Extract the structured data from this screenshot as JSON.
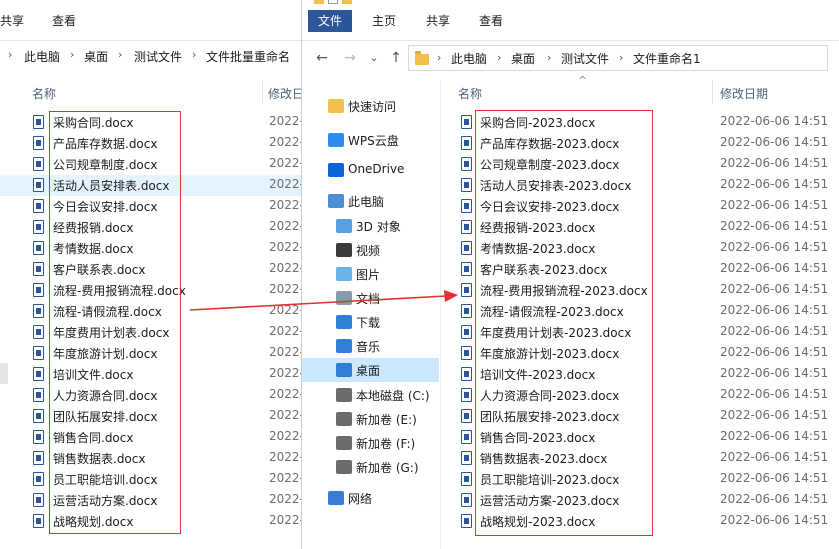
{
  "back_window": {
    "ribbon_tabs": [
      "共享",
      "查看"
    ],
    "breadcrumb": [
      "此电脑",
      "桌面",
      "测试文件",
      "文件批量重命名"
    ],
    "col_name": "名称",
    "col_date": "修改日",
    "files": [
      {
        "name": "采购合同.docx",
        "date": "2022-"
      },
      {
        "name": "产品库存数据.docx",
        "date": "2022-"
      },
      {
        "name": "公司规章制度.docx",
        "date": "2022-"
      },
      {
        "name": "活动人员安排表.docx",
        "date": "2022-"
      },
      {
        "name": "今日会议安排.docx",
        "date": "2022-"
      },
      {
        "name": "经费报销.docx",
        "date": "2022-"
      },
      {
        "name": "考情数据.docx",
        "date": "2022-"
      },
      {
        "name": "客户联系表.docx",
        "date": "2022-"
      },
      {
        "name": "流程-费用报销流程.docx",
        "date": "2022-"
      },
      {
        "name": "流程-请假流程.docx",
        "date": "2022-"
      },
      {
        "name": "年度费用计划表.docx",
        "date": "2022-"
      },
      {
        "name": "年度旅游计划.docx",
        "date": "2022-"
      },
      {
        "name": "培训文件.docx",
        "date": "2022-"
      },
      {
        "name": "人力资源合同.docx",
        "date": "2022-"
      },
      {
        "name": "团队拓展安排.docx",
        "date": "2022-"
      },
      {
        "name": "销售合同.docx",
        "date": "2022-"
      },
      {
        "name": "销售数据表.docx",
        "date": "2022-"
      },
      {
        "name": "员工职能培训.docx",
        "date": "2022-"
      },
      {
        "name": "运营活动方案.docx",
        "date": "2022-"
      },
      {
        "name": "战略规划.docx",
        "date": "2022-"
      }
    ]
  },
  "front_window": {
    "ribbon_tabs": [
      "文件",
      "主页",
      "共享",
      "查看"
    ],
    "breadcrumb": [
      "此电脑",
      "桌面",
      "测试文件",
      "文件重命名1"
    ],
    "nav_back": "←",
    "nav_forward": "→",
    "nav_recent": "⌄",
    "nav_up": "↑",
    "col_name": "名称",
    "col_date": "修改日期",
    "sort_indicator": "^",
    "nav_pane": [
      {
        "label": "快速访问",
        "icon": "quick-access-icon"
      },
      {
        "label": "WPS云盘",
        "icon": "cloud-icon"
      },
      {
        "label": "OneDrive",
        "icon": "onedrive-icon"
      },
      {
        "label": "此电脑",
        "icon": "computer-icon"
      },
      {
        "label": "3D 对象",
        "icon": "3d-objects-icon"
      },
      {
        "label": "视频",
        "icon": "video-icon"
      },
      {
        "label": "图片",
        "icon": "pictures-icon"
      },
      {
        "label": "文档",
        "icon": "documents-icon"
      },
      {
        "label": "下载",
        "icon": "download-icon"
      },
      {
        "label": "音乐",
        "icon": "music-icon"
      },
      {
        "label": "桌面",
        "icon": "desktop-icon"
      },
      {
        "label": "本地磁盘 (C:)",
        "icon": "drive-c-icon"
      },
      {
        "label": "新加卷 (E:)",
        "icon": "drive-e-icon"
      },
      {
        "label": "新加卷 (F:)",
        "icon": "drive-f-icon"
      },
      {
        "label": "新加卷 (G:)",
        "icon": "drive-g-icon"
      },
      {
        "label": "网络",
        "icon": "network-icon"
      }
    ],
    "files": [
      {
        "name": "采购合同-2023.docx",
        "date": "2022-06-06 14:51"
      },
      {
        "name": "产品库存数据-2023.docx",
        "date": "2022-06-06 14:51"
      },
      {
        "name": "公司规章制度-2023.docx",
        "date": "2022-06-06 14:51"
      },
      {
        "name": "活动人员安排表-2023.docx",
        "date": "2022-06-06 14:51"
      },
      {
        "name": "今日会议安排-2023.docx",
        "date": "2022-06-06 14:51"
      },
      {
        "name": "经费报销-2023.docx",
        "date": "2022-06-06 14:51"
      },
      {
        "name": "考情数据-2023.docx",
        "date": "2022-06-06 14:51"
      },
      {
        "name": "客户联系表-2023.docx",
        "date": "2022-06-06 14:51"
      },
      {
        "name": "流程-费用报销流程-2023.docx",
        "date": "2022-06-06 14:51"
      },
      {
        "name": "流程-请假流程-2023.docx",
        "date": "2022-06-06 14:51"
      },
      {
        "name": "年度费用计划表-2023.docx",
        "date": "2022-06-06 14:51"
      },
      {
        "name": "年度旅游计划-2023.docx",
        "date": "2022-06-06 14:51"
      },
      {
        "name": "培训文件-2023.docx",
        "date": "2022-06-06 14:51"
      },
      {
        "name": "人力资源合同-2023.docx",
        "date": "2022-06-06 14:51"
      },
      {
        "name": "团队拓展安排-2023.docx",
        "date": "2022-06-06 14:51"
      },
      {
        "name": "销售合同-2023.docx",
        "date": "2022-06-06 14:51"
      },
      {
        "name": "销售数据表-2023.docx",
        "date": "2022-06-06 14:51"
      },
      {
        "name": "员工职能培训-2023.docx",
        "date": "2022-06-06 14:51"
      },
      {
        "name": "运营活动方案-2023.docx",
        "date": "2022-06-06 14:51"
      },
      {
        "name": "战略规划-2023.docx",
        "date": "2022-06-06 14:51"
      }
    ]
  },
  "colors": {
    "ribbon_active": "#2b579a",
    "selection": "#cce8ff",
    "highlight_box": "#e03030",
    "arrow": "#e03030",
    "word_icon": "#2b5797"
  }
}
